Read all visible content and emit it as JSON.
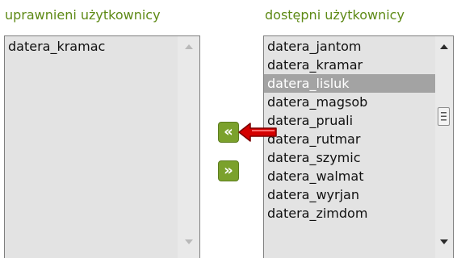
{
  "headings": {
    "assigned_users": "uprawnieni użytkownicy",
    "available_users": "dostępni użytkownicy"
  },
  "assigned_list": {
    "items": [
      "datera_kramac"
    ]
  },
  "available_list": {
    "items": [
      "datera_jantom",
      "datera_kramar",
      "datera_lisluk",
      "datera_magsob",
      "datera_pruali",
      "datera_rutmar",
      "datera_szymic",
      "datera_walmat",
      "datera_wyrjan",
      "datera_zimdom"
    ],
    "selected_item": "datera_lisluk"
  },
  "buttons": {
    "move_left_label": "«",
    "move_right_label": "»"
  },
  "colors": {
    "heading": "#5e8a16",
    "button": "#7ba12c",
    "selection": "#a3a3a3",
    "list_background": "#e3e3e3",
    "annotation_arrow": "#d40000"
  },
  "icons": {
    "scroll_up": "triangle-up-icon",
    "scroll_down": "triangle-down-icon",
    "scroll_thumb": "grip-lines-icon",
    "annotation": "red-arrow-icon"
  }
}
